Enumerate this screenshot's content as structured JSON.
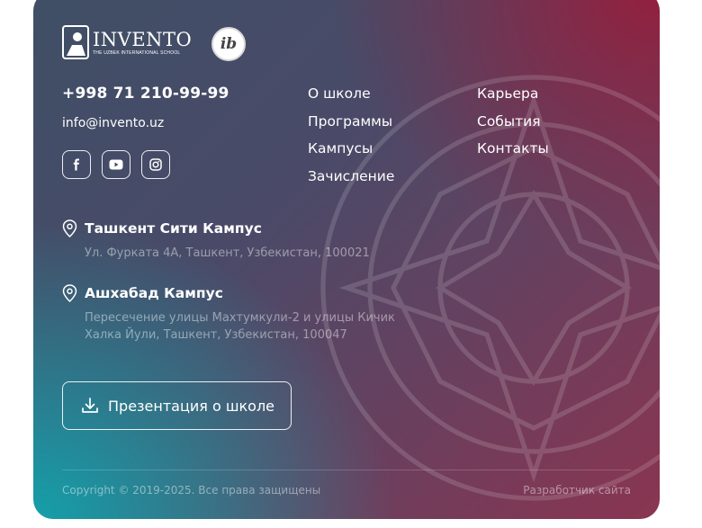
{
  "brand": {
    "logo_word": "INVENTO",
    "logo_sub": "THE UZBEK INTERNATIONAL SCHOOL",
    "ib_badge": "ib"
  },
  "contacts": {
    "phone": "+998 71 210-99-99",
    "email": "info@invento.uz"
  },
  "socials": [
    {
      "icon": "facebook-icon"
    },
    {
      "icon": "youtube-icon"
    },
    {
      "icon": "instagram-icon"
    }
  ],
  "nav": {
    "col1": [
      "О школе",
      "Программы",
      "Кампусы",
      "Зачисление"
    ],
    "col2": [
      "Карьера",
      "События",
      "Контакты"
    ]
  },
  "campuses": [
    {
      "name": "Ташкент Сити Кампус",
      "address": "Ул. Фурката 4А, Ташкент, Узбекистан, 100021"
    },
    {
      "name": "Ашхабад Кампус",
      "address_line1": "Пересечение улицы Махтумкули-2 и улицы Кичик",
      "address_line2": "Халка Йули, Ташкент, Узбекистан, 100047"
    }
  ],
  "presentation": {
    "label": "Презентация о школе",
    "icon": "download-icon"
  },
  "footer": {
    "copyright": "Copyright © 2019-2025. Все права защищены",
    "developer": "Разработчик сайта"
  },
  "colors": {
    "top_right": "#961e3c",
    "bottom_left": "#14a0aa",
    "mid": "#4a4a68"
  }
}
